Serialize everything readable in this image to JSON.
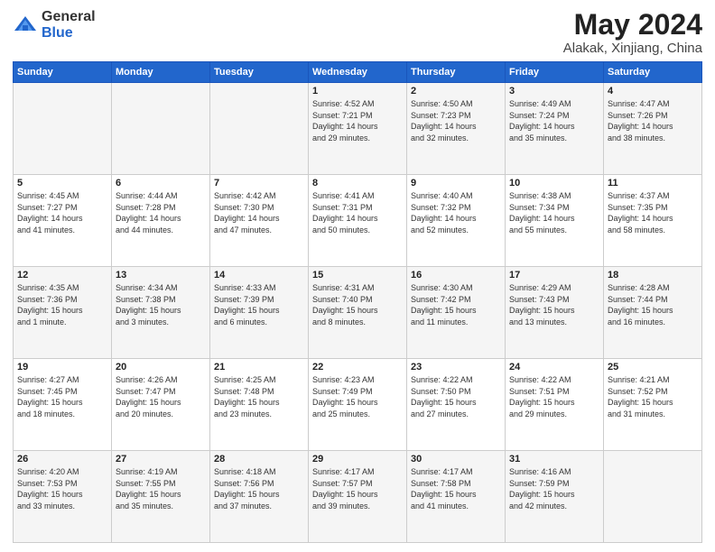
{
  "logo": {
    "general": "General",
    "blue": "Blue"
  },
  "title": {
    "month_year": "May 2024",
    "location": "Alakak, Xinjiang, China"
  },
  "weekdays": [
    "Sunday",
    "Monday",
    "Tuesday",
    "Wednesday",
    "Thursday",
    "Friday",
    "Saturday"
  ],
  "weeks": [
    [
      {
        "day": "",
        "info": ""
      },
      {
        "day": "",
        "info": ""
      },
      {
        "day": "",
        "info": ""
      },
      {
        "day": "1",
        "info": "Sunrise: 4:52 AM\nSunset: 7:21 PM\nDaylight: 14 hours\nand 29 minutes."
      },
      {
        "day": "2",
        "info": "Sunrise: 4:50 AM\nSunset: 7:23 PM\nDaylight: 14 hours\nand 32 minutes."
      },
      {
        "day": "3",
        "info": "Sunrise: 4:49 AM\nSunset: 7:24 PM\nDaylight: 14 hours\nand 35 minutes."
      },
      {
        "day": "4",
        "info": "Sunrise: 4:47 AM\nSunset: 7:26 PM\nDaylight: 14 hours\nand 38 minutes."
      }
    ],
    [
      {
        "day": "5",
        "info": "Sunrise: 4:45 AM\nSunset: 7:27 PM\nDaylight: 14 hours\nand 41 minutes."
      },
      {
        "day": "6",
        "info": "Sunrise: 4:44 AM\nSunset: 7:28 PM\nDaylight: 14 hours\nand 44 minutes."
      },
      {
        "day": "7",
        "info": "Sunrise: 4:42 AM\nSunset: 7:30 PM\nDaylight: 14 hours\nand 47 minutes."
      },
      {
        "day": "8",
        "info": "Sunrise: 4:41 AM\nSunset: 7:31 PM\nDaylight: 14 hours\nand 50 minutes."
      },
      {
        "day": "9",
        "info": "Sunrise: 4:40 AM\nSunset: 7:32 PM\nDaylight: 14 hours\nand 52 minutes."
      },
      {
        "day": "10",
        "info": "Sunrise: 4:38 AM\nSunset: 7:34 PM\nDaylight: 14 hours\nand 55 minutes."
      },
      {
        "day": "11",
        "info": "Sunrise: 4:37 AM\nSunset: 7:35 PM\nDaylight: 14 hours\nand 58 minutes."
      }
    ],
    [
      {
        "day": "12",
        "info": "Sunrise: 4:35 AM\nSunset: 7:36 PM\nDaylight: 15 hours\nand 1 minute."
      },
      {
        "day": "13",
        "info": "Sunrise: 4:34 AM\nSunset: 7:38 PM\nDaylight: 15 hours\nand 3 minutes."
      },
      {
        "day": "14",
        "info": "Sunrise: 4:33 AM\nSunset: 7:39 PM\nDaylight: 15 hours\nand 6 minutes."
      },
      {
        "day": "15",
        "info": "Sunrise: 4:31 AM\nSunset: 7:40 PM\nDaylight: 15 hours\nand 8 minutes."
      },
      {
        "day": "16",
        "info": "Sunrise: 4:30 AM\nSunset: 7:42 PM\nDaylight: 15 hours\nand 11 minutes."
      },
      {
        "day": "17",
        "info": "Sunrise: 4:29 AM\nSunset: 7:43 PM\nDaylight: 15 hours\nand 13 minutes."
      },
      {
        "day": "18",
        "info": "Sunrise: 4:28 AM\nSunset: 7:44 PM\nDaylight: 15 hours\nand 16 minutes."
      }
    ],
    [
      {
        "day": "19",
        "info": "Sunrise: 4:27 AM\nSunset: 7:45 PM\nDaylight: 15 hours\nand 18 minutes."
      },
      {
        "day": "20",
        "info": "Sunrise: 4:26 AM\nSunset: 7:47 PM\nDaylight: 15 hours\nand 20 minutes."
      },
      {
        "day": "21",
        "info": "Sunrise: 4:25 AM\nSunset: 7:48 PM\nDaylight: 15 hours\nand 23 minutes."
      },
      {
        "day": "22",
        "info": "Sunrise: 4:23 AM\nSunset: 7:49 PM\nDaylight: 15 hours\nand 25 minutes."
      },
      {
        "day": "23",
        "info": "Sunrise: 4:22 AM\nSunset: 7:50 PM\nDaylight: 15 hours\nand 27 minutes."
      },
      {
        "day": "24",
        "info": "Sunrise: 4:22 AM\nSunset: 7:51 PM\nDaylight: 15 hours\nand 29 minutes."
      },
      {
        "day": "25",
        "info": "Sunrise: 4:21 AM\nSunset: 7:52 PM\nDaylight: 15 hours\nand 31 minutes."
      }
    ],
    [
      {
        "day": "26",
        "info": "Sunrise: 4:20 AM\nSunset: 7:53 PM\nDaylight: 15 hours\nand 33 minutes."
      },
      {
        "day": "27",
        "info": "Sunrise: 4:19 AM\nSunset: 7:55 PM\nDaylight: 15 hours\nand 35 minutes."
      },
      {
        "day": "28",
        "info": "Sunrise: 4:18 AM\nSunset: 7:56 PM\nDaylight: 15 hours\nand 37 minutes."
      },
      {
        "day": "29",
        "info": "Sunrise: 4:17 AM\nSunset: 7:57 PM\nDaylight: 15 hours\nand 39 minutes."
      },
      {
        "day": "30",
        "info": "Sunrise: 4:17 AM\nSunset: 7:58 PM\nDaylight: 15 hours\nand 41 minutes."
      },
      {
        "day": "31",
        "info": "Sunrise: 4:16 AM\nSunset: 7:59 PM\nDaylight: 15 hours\nand 42 minutes."
      },
      {
        "day": "",
        "info": ""
      }
    ]
  ]
}
